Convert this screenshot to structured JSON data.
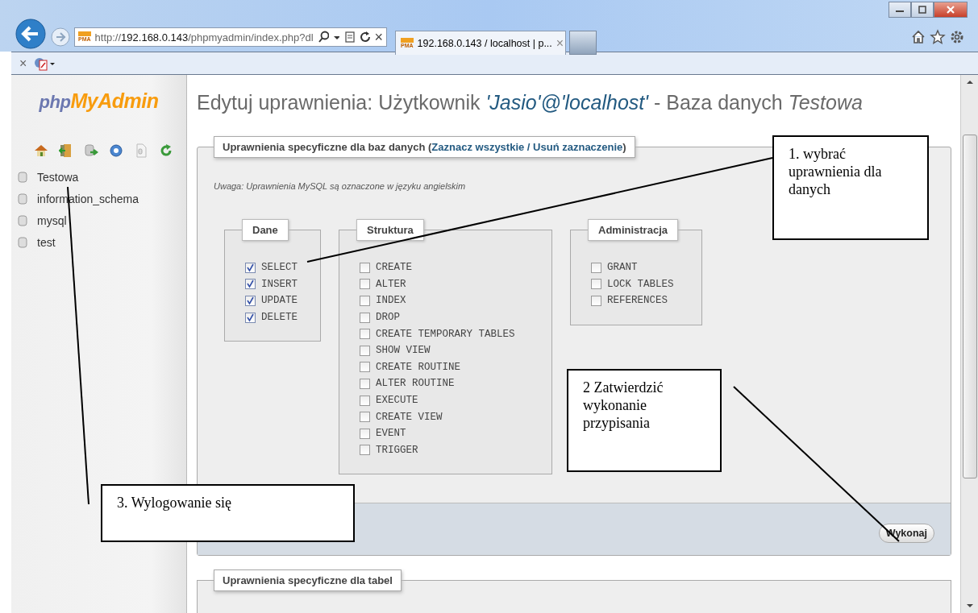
{
  "browser": {
    "url_scheme": "http://",
    "url_host": "192.168.0.143",
    "url_path": "/phpmyadmin/index.php?dl",
    "favicon_text": "PMA",
    "tab": {
      "favicon_text": "PMA",
      "title": "192.168.0.143 / localhost | p...",
      "close": "×"
    },
    "stop": "×"
  },
  "sidebar": {
    "logo_php": "php",
    "logo_myadmin": "MyAdmin",
    "databases": [
      "Testowa",
      "information_schema",
      "mysql",
      "test"
    ]
  },
  "title": {
    "prefix": "Edytuj uprawnienia: Użytkownik ",
    "user": "'Jasio'@'localhost'",
    "middle": " - Baza danych ",
    "database": "Testowa"
  },
  "db_privileges": {
    "legend": "Uprawnienia specyficzne dla baz danych (",
    "select_all": "Zaznacz wszystkie",
    "separator": " / ",
    "unselect_all": "Usuń zaznaczenie",
    "legend_end": ")",
    "note": "Uwaga: Uprawnienia MySQL są oznaczone w języku angielskim",
    "groups": [
      {
        "title": "Dane",
        "items": [
          {
            "label": "SELECT",
            "checked": true
          },
          {
            "label": "INSERT",
            "checked": true
          },
          {
            "label": "UPDATE",
            "checked": true
          },
          {
            "label": "DELETE",
            "checked": true
          }
        ]
      },
      {
        "title": "Struktura",
        "items": [
          {
            "label": "CREATE",
            "checked": false
          },
          {
            "label": "ALTER",
            "checked": false
          },
          {
            "label": "INDEX",
            "checked": false
          },
          {
            "label": "DROP",
            "checked": false
          },
          {
            "label": "CREATE TEMPORARY TABLES",
            "checked": false
          },
          {
            "label": "SHOW VIEW",
            "checked": false
          },
          {
            "label": "CREATE ROUTINE",
            "checked": false
          },
          {
            "label": "ALTER ROUTINE",
            "checked": false
          },
          {
            "label": "EXECUTE",
            "checked": false
          },
          {
            "label": "CREATE VIEW",
            "checked": false
          },
          {
            "label": "EVENT",
            "checked": false
          },
          {
            "label": "TRIGGER",
            "checked": false
          }
        ]
      },
      {
        "title": "Administracja",
        "items": [
          {
            "label": "GRANT",
            "checked": false
          },
          {
            "label": "LOCK TABLES",
            "checked": false
          },
          {
            "label": "REFERENCES",
            "checked": false
          }
        ]
      }
    ],
    "submit": "Wykonaj"
  },
  "table_privileges": {
    "legend": "Uprawnienia specyficzne dla tabel"
  },
  "annotations": [
    "1. wybrać uprawnienia dla danych",
    "2 Zatwierdzić wykonanie przypisania",
    "3. Wylogowanie się"
  ]
}
